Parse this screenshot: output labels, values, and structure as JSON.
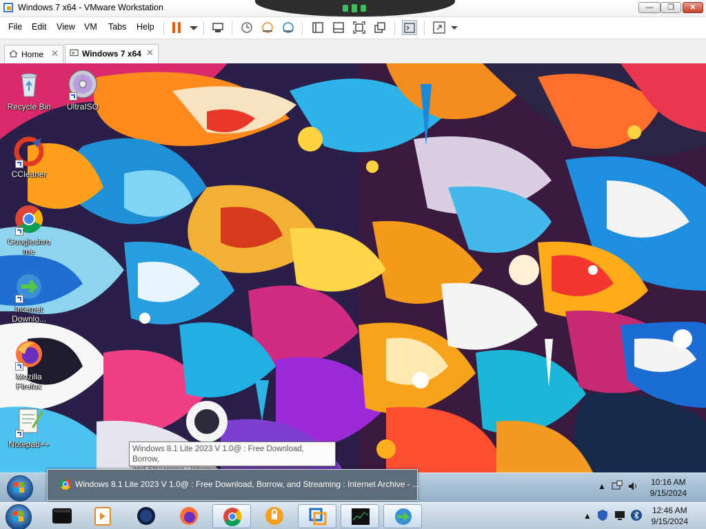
{
  "window": {
    "title": "Windows 7 x64 - VMware Workstation",
    "controls": {
      "minimize": "—",
      "restore": "❐",
      "close": "✕"
    }
  },
  "menu": {
    "items": [
      "File",
      "Edit",
      "View",
      "VM",
      "Tabs",
      "Help"
    ]
  },
  "toolbar": {
    "icons": [
      "pause-icon",
      "dropdown-icon",
      "send-ctrl-alt-del-icon",
      "snapshot-icon",
      "revert-snapshot-icon",
      "snapshot-manager-icon",
      "library-icon",
      "thumbnail-icon",
      "fullscreen-icon",
      "unity-icon",
      "console-icon",
      "stretch-icon",
      "dropdown-icon"
    ]
  },
  "tabs": [
    {
      "label": "Home",
      "active": false
    },
    {
      "label": "Windows 7 x64",
      "active": true
    }
  ],
  "desktop": {
    "icons": [
      {
        "label": "Recycle Bin",
        "icon": "recycle-bin-icon",
        "shortcut": false
      },
      {
        "label": "UltraISO",
        "icon": "disc-icon",
        "shortcut": true
      },
      {
        "label": "CCleaner",
        "icon": "ccleaner-icon",
        "shortcut": true
      },
      {
        "label": "Googlechrome",
        "icon": "chrome-icon",
        "shortcut": true
      },
      {
        "label": "Internet Downlo...",
        "icon": "idm-icon",
        "shortcut": true
      },
      {
        "label": "Mozilla Firefox",
        "icon": "firefox-icon",
        "shortcut": true
      },
      {
        "label": "Notepad++",
        "icon": "notepad-icon",
        "shortcut": true
      }
    ],
    "tooltip": {
      "line1": "Windows 8.1 Lite 2023 V 1.0@ : Free Download, Borrow,",
      "line2": "and Streaming : Internet Archive - Google Chrome"
    }
  },
  "guest_taskbar": {
    "task_label": "Windows 8.1 Lite 2023 V 1.0@ : Free Download, Borrow, and Streaming : Internet Archive - ...",
    "tray_arrow": "▲",
    "time": "10:16 AM",
    "date": "9/15/2024"
  },
  "host_taskbar": {
    "apps": [
      "terminal-app",
      "media-player-app",
      "globe-app",
      "firefox-app",
      "chrome-app",
      "vpn-app",
      "vmware-app",
      "monitor-app",
      "idm-app"
    ],
    "tray_arrow": "▲",
    "time": "12:46 AM",
    "date": "9/15/2024"
  },
  "colors": {
    "vm_orange": "#e05a1e",
    "guest_taskbar": "#a8c1d6",
    "host_taskbar": "#c8d7e5"
  }
}
